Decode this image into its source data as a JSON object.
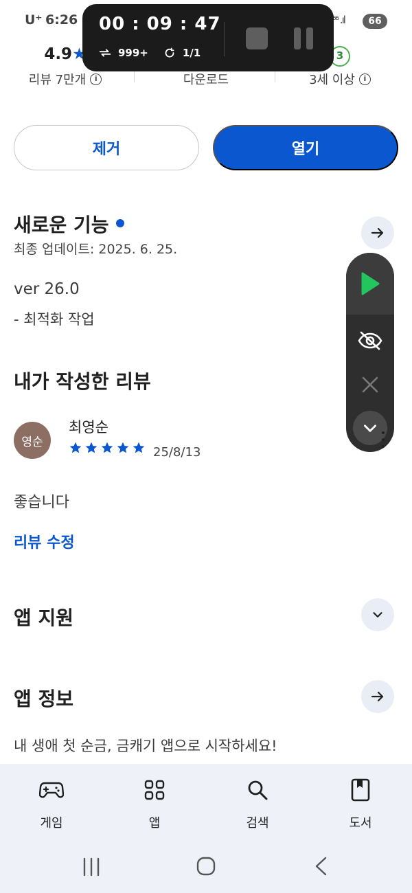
{
  "status_bar": {
    "carrier": "U⁺",
    "time": "6:26",
    "signal": "⁵⁶ .ıl",
    "battery": "66"
  },
  "stats": {
    "rating_value": "4.9",
    "rating_label": "리뷰 7만개",
    "downloads_label": "다운로드",
    "age_badge": "3",
    "age_label": "3세 이상"
  },
  "actions": {
    "remove_label": "제거",
    "open_label": "열기"
  },
  "whats_new": {
    "title": "새로운 기능",
    "updated": "최종 업데이트: 2025. 6. 25.",
    "version": "ver 26.0",
    "notes": "- 최적화 작업"
  },
  "my_review": {
    "title": "내가 작성한 리뷰",
    "avatar_text": "영순",
    "reviewer": "최영순",
    "stars": 5,
    "date": "25/8/13",
    "text": "좋습니다",
    "edit_label": "리뷰 수정"
  },
  "app_support": {
    "title": "앱 지원"
  },
  "app_info": {
    "title": "앱 정보",
    "description": "내 생애 첫 순금, 금캐기 앱으로 시작하세요!"
  },
  "recorder": {
    "elapsed": "00 : 09 : 47",
    "loop_count": "999+",
    "repeat_count": "1/1"
  },
  "bottom_nav": [
    {
      "label": "게임",
      "icon": "gamepad-icon"
    },
    {
      "label": "앱",
      "icon": "apps-grid-icon"
    },
    {
      "label": "검색",
      "icon": "search-icon"
    },
    {
      "label": "도서",
      "icon": "book-icon"
    }
  ],
  "colors": {
    "accent": "#0b57d0",
    "play_green": "#22c55e",
    "nav_bg": "#eef2f8",
    "avatar": "#8d6e63"
  }
}
